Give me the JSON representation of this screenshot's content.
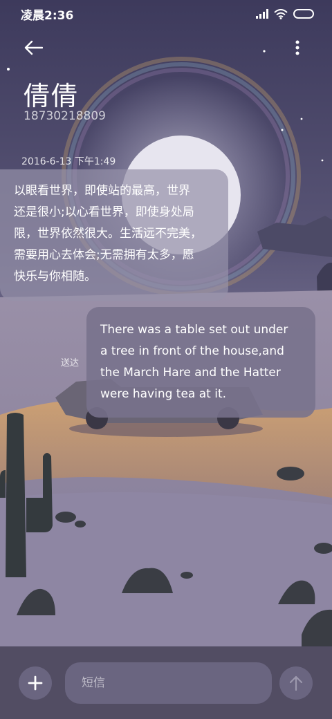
{
  "status_bar": {
    "time": "凌晨2:36",
    "icons": [
      "signal-icon",
      "wifi-icon",
      "battery-icon"
    ]
  },
  "header": {
    "back_icon": "arrow-left-icon",
    "more_icon": "more-vertical-icon",
    "contact_name": "倩倩",
    "contact_phone": "18730218809"
  },
  "conversation": {
    "timestamp": "2016-6-13 下午1:49",
    "messages": [
      {
        "direction": "incoming",
        "lines": [
          "以眼看世界，即使站的最高，世界",
          "还是很小;以心看世界，即使身处局",
          "限，世界依然很大。生活远不完美，",
          "需要用心去体会;无需拥有太多，愿",
          "快乐与你相随。"
        ]
      },
      {
        "direction": "outgoing",
        "lines": [
          "There was a table set out under",
          "a tree in front of the house,and",
          "the March Hare and the Hatter",
          "were having tea at it."
        ],
        "status": "送达"
      }
    ]
  },
  "composer": {
    "add_icon": "plus-icon",
    "placeholder": "短信",
    "value": "",
    "send_icon": "arrow-up-icon"
  },
  "colors": {
    "sky": "#5e5a7c",
    "bottom_bar": "#524d63",
    "input_bg": "#6a6580",
    "incoming_bubble": "#9692aa",
    "outgoing_bubble": "#78728c"
  }
}
